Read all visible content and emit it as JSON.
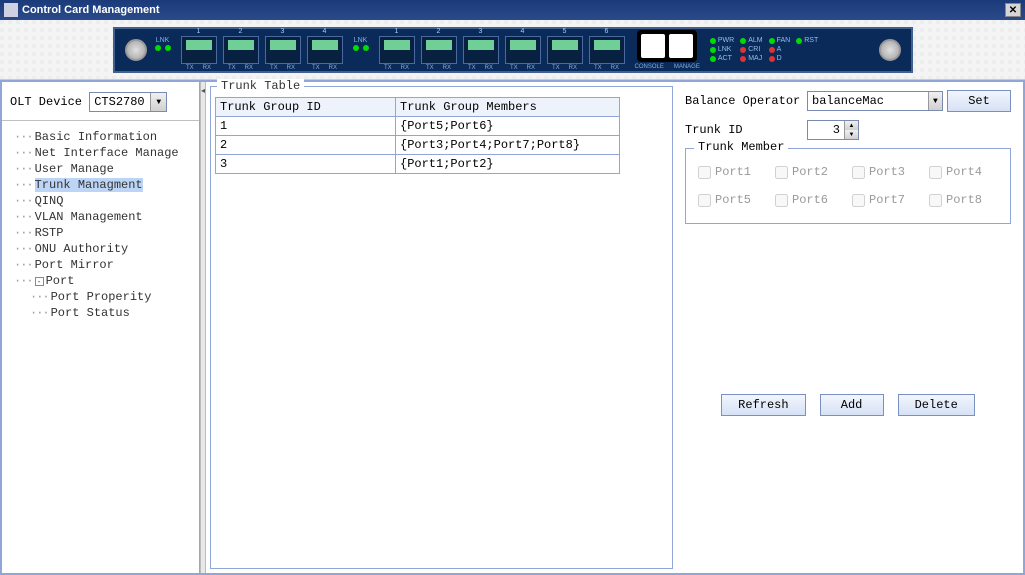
{
  "window": {
    "title": "Control Card Management"
  },
  "sidebar": {
    "olt_label": "OLT Device",
    "olt_value": "CTS2780",
    "nodes": [
      {
        "label": "Basic Information",
        "sel": false
      },
      {
        "label": "Net Interface Manage",
        "sel": false
      },
      {
        "label": "User Manage",
        "sel": false
      },
      {
        "label": "Trunk Managment",
        "sel": true
      },
      {
        "label": "QINQ",
        "sel": false
      },
      {
        "label": "VLAN Management",
        "sel": false
      },
      {
        "label": "RSTP",
        "sel": false
      },
      {
        "label": "ONU Authority",
        "sel": false
      },
      {
        "label": "Port Mirror",
        "sel": false
      }
    ],
    "port_node": "Port",
    "port_children": [
      "Port Properity",
      "Port Status"
    ]
  },
  "trunk_table": {
    "title": "Trunk Table",
    "columns": [
      "Trunk Group ID",
      "Trunk Group Members"
    ],
    "rows": [
      {
        "id": "1",
        "members": "{Port5;Port6}"
      },
      {
        "id": "2",
        "members": "{Port3;Port4;Port7;Port8}"
      },
      {
        "id": "3",
        "members": "{Port1;Port2}"
      }
    ]
  },
  "right": {
    "balance_label": "Balance Operator",
    "balance_value": "balanceMac",
    "set_btn": "Set",
    "trunk_id_label": "Trunk ID",
    "trunk_id_value": "3",
    "member_legend": "Trunk Member",
    "ports": [
      "Port1",
      "Port2",
      "Port3",
      "Port4",
      "Port5",
      "Port6",
      "Port7",
      "Port8"
    ],
    "refresh": "Refresh",
    "add": "Add",
    "delete": "Delete"
  },
  "device": {
    "port_numbers": [
      "1",
      "2",
      "3",
      "4",
      "1",
      "2",
      "3",
      "4",
      "5",
      "6"
    ],
    "lnk": "LNK",
    "tx": "TX",
    "rx": "RX",
    "console": "CONSOLE",
    "manage": "MANAGE",
    "stats": [
      "PWR",
      "ALM",
      "FAN",
      "RST",
      "LNK",
      "CRI",
      "A",
      "",
      "ACT",
      "MAJ",
      "D",
      ""
    ]
  }
}
